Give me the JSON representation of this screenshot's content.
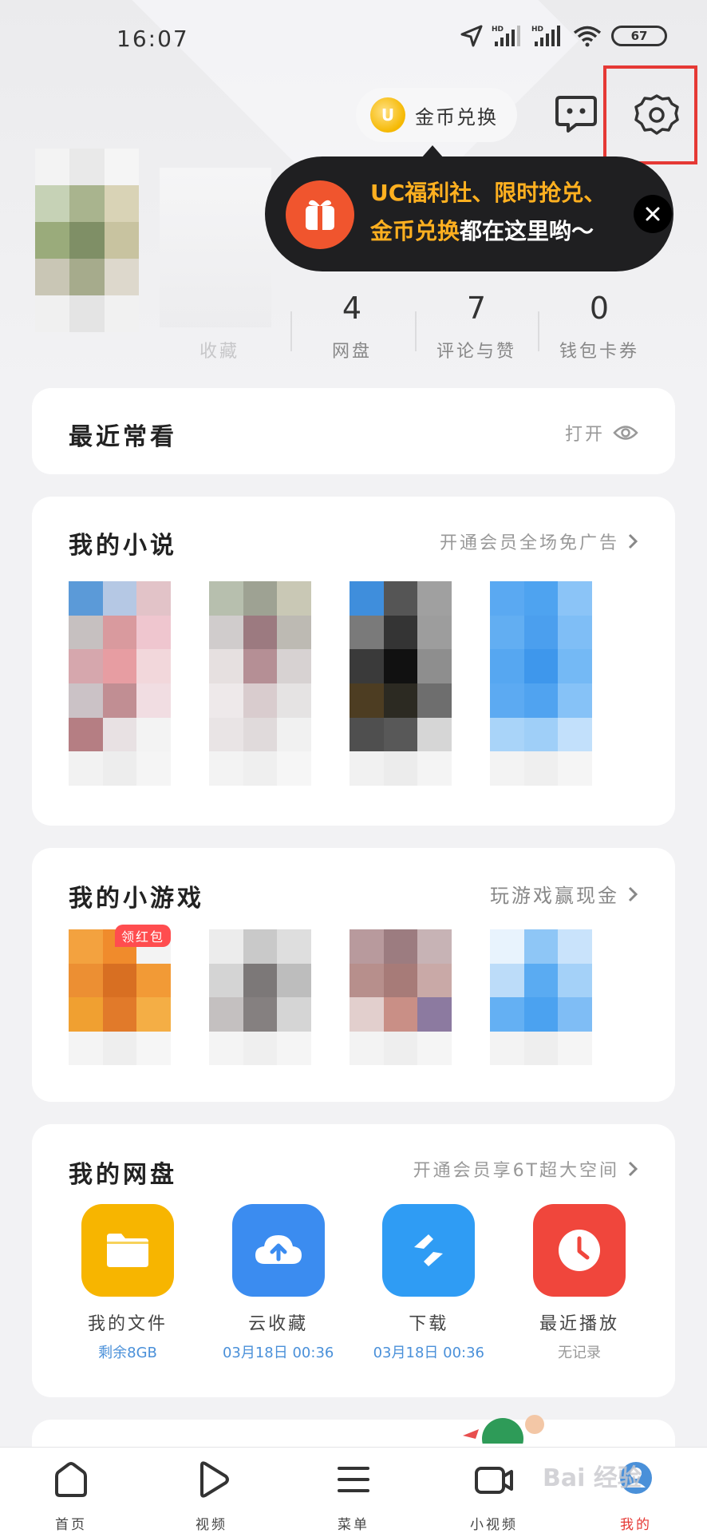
{
  "status": {
    "time": "16:07",
    "battery": "67",
    "net1": "HD",
    "net2": "HD"
  },
  "topbar": {
    "coin_label": "金币兑换",
    "coin_glyph": "U"
  },
  "tooltip": {
    "line1_hl": "UC福利社、限时抢兑、",
    "line2_hl": "金币兑换",
    "line2_rest": "都在这里哟～"
  },
  "stats": [
    {
      "num": "4",
      "label": "网盘"
    },
    {
      "num": "7",
      "label": "评论与赞"
    },
    {
      "num": "0",
      "label": "钱包卡券"
    }
  ],
  "stats_partial_label": "收藏",
  "recent": {
    "title": "最近常看",
    "action": "打开"
  },
  "novels": {
    "title": "我的小说",
    "link": "开通会员全场免广告"
  },
  "games": {
    "title": "我的小游戏",
    "link": "玩游戏赢现金",
    "badge": "领红包"
  },
  "disk": {
    "title": "我的网盘",
    "link": "开通会员享6T超大空间",
    "items": [
      {
        "label": "我的文件",
        "sub": "剩余8GB",
        "color": "#f7b500",
        "icon": "folder-icon"
      },
      {
        "label": "云收藏",
        "sub": "03月18日 00:36",
        "color": "#3b8cf0",
        "icon": "cloud-upload-icon"
      },
      {
        "label": "下载",
        "sub": "03月18日 00:36",
        "color": "#2f9cf4",
        "icon": "download-icon"
      },
      {
        "label": "最近播放",
        "sub": "无记录",
        "color": "#f0463c",
        "icon": "clock-icon"
      }
    ]
  },
  "nav": [
    {
      "label": "首页",
      "icon": "home-icon"
    },
    {
      "label": "视频",
      "icon": "play-icon"
    },
    {
      "label": "菜单",
      "icon": "menu-icon"
    },
    {
      "label": "小视频",
      "icon": "camera-icon"
    },
    {
      "label": "我的",
      "icon": "profile-icon"
    }
  ],
  "watermark": "Bai 经验",
  "colors": {
    "accent": "#ffb020",
    "highlight": "#e53935",
    "gift": "#f0552e"
  }
}
